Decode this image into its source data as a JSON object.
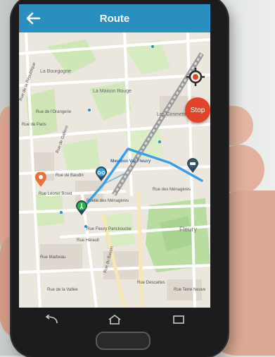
{
  "app": {
    "title": "Route",
    "stop_label": "Stop"
  },
  "icons": {
    "back": "arrow-left-icon",
    "target": "crosshair-target-icon",
    "bike_pin": "bicycle-pin-icon",
    "walk_pin": "walker-pin-icon",
    "car_pin": "car-pin-icon",
    "start_pin": "start-marker-icon",
    "nav_back": "android-back-icon",
    "nav_home": "android-home-icon",
    "nav_recent": "android-recent-apps-icon"
  },
  "map": {
    "labels": {
      "la_bourgogne": "La Bourgogne",
      "la_maison_rouge": "La Maison Rouge",
      "les_gimmettes": "Les Gimmettes",
      "meudon_val_fleury": "Meudon Val Fleury",
      "rue_de_la_republique": "Rue de la République",
      "rue_de_lorangerie": "Rue de l'Orangerie",
      "rue_de_paris": "Rue de Paris",
      "rue_de_gallieni": "Rue de Gallieni",
      "rue_de_baudin": "Rue de Baudin",
      "rue_leonie_bowd": "Rue Léonie Bowd",
      "ruelle_des_menagieres": "Ruelle des Ménagères",
      "rue_des_menageres": "Rue des Ménagères",
      "rue_fleury_panckoucke": "Rue Fleury Panckoucke",
      "rue_heraulf": "Rue Hérault",
      "fleury": "Fleury",
      "rue_marbeau": "Rue Marbeau",
      "rue_dexcartes": "Rue Descartes",
      "rue_de_la_vallee": "Rue de la Vallée",
      "rue_du_bassin": "Rue du Bassin",
      "rue_terre_neuve": "Rue Terre Neuve"
    }
  },
  "colors": {
    "appbar": "#2a8fbf",
    "route": "#3aa0e6",
    "stop": "#e0452a"
  }
}
